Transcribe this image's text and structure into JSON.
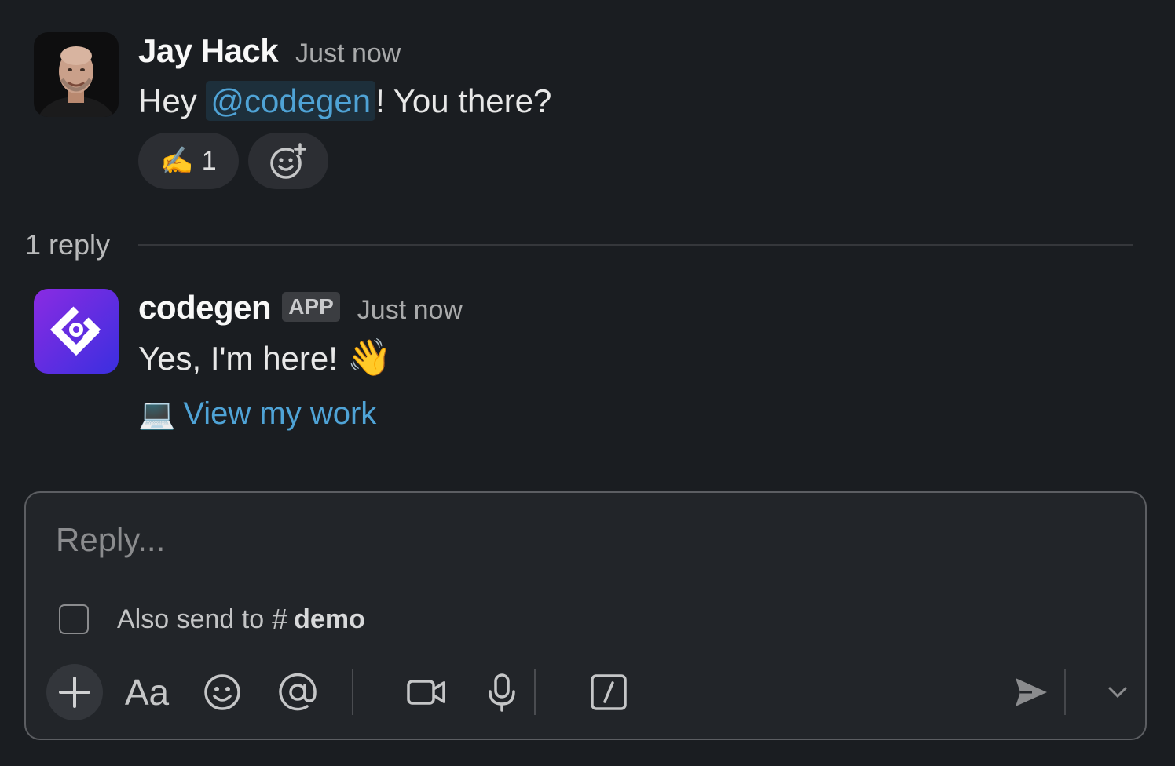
{
  "message": {
    "author": "Jay Hack",
    "time": "Just now",
    "text_before": "Hey ",
    "mention": "@codegen",
    "text_after": "! You there?",
    "reactions": [
      {
        "emoji": "✍️",
        "count": "1"
      }
    ],
    "add_reaction_icon": "add-reaction-icon"
  },
  "thread": {
    "reply_count": "1 reply"
  },
  "reply": {
    "author": "codegen",
    "badge": "APP",
    "time": "Just now",
    "text": "Yes, I'm here!",
    "wave_emoji": "👋",
    "laptop_emoji": "💻",
    "link_text": "View my work"
  },
  "composer": {
    "placeholder": "Reply...",
    "also_send_label": "Also send to",
    "hash": "#",
    "channel": "demo",
    "format_label": "Aa"
  },
  "colors": {
    "background": "#1a1d21",
    "link": "#4fa3d6",
    "codegen_gradient_start": "#7b2ff7",
    "codegen_gradient_end": "#3d2bd9"
  }
}
